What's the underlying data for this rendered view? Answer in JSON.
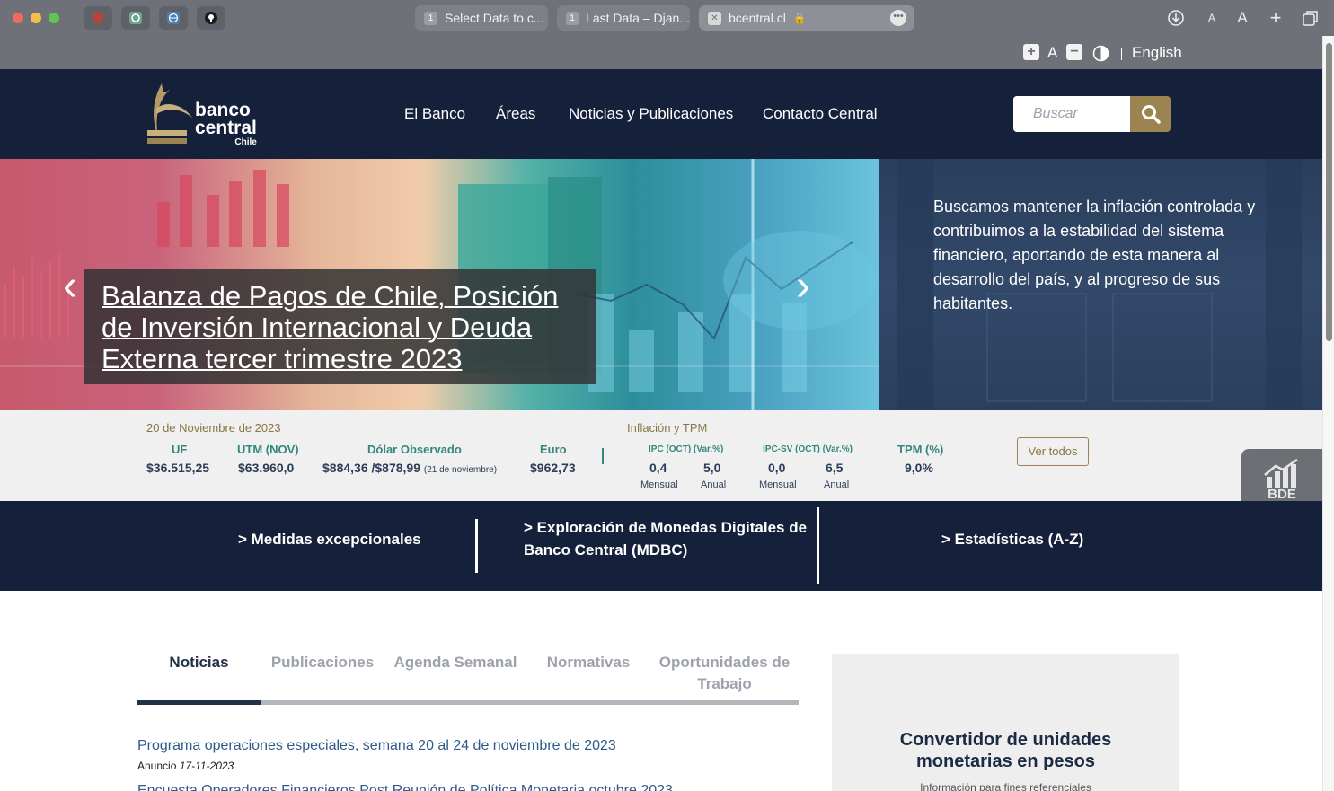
{
  "browser": {
    "tabs": [
      {
        "count": "1",
        "label": "Select Data to c..."
      },
      {
        "count": "1",
        "label": "Last Data – Djan..."
      },
      {
        "label": "bcentral.cl"
      }
    ],
    "extensions": [
      "shield-icon",
      "chatgpt-icon",
      "globe-icon",
      "github-icon"
    ],
    "colors": {
      "chrome": "#6e7177"
    }
  },
  "a11y": {
    "font_increase": "+",
    "font_label": "A",
    "font_decrease": "−",
    "language": "English"
  },
  "header": {
    "logo": {
      "line1": "banco",
      "line2": "central",
      "line3": "Chile"
    },
    "nav": [
      "El Banco",
      "Áreas",
      "Noticias y Publicaciones",
      "Contacto Central"
    ],
    "search_placeholder": "Buscar",
    "colors": {
      "navy": "#15213a",
      "gold": "#9b8451"
    }
  },
  "hero": {
    "slide_title": "Balanza de Pagos de Chile, Posición de Inversión Internacional y Deuda Externa tercer trimestre 2023",
    "mission": "Buscamos mantener la inflación controlada y contribuimos a la estabilidad del sistema financiero, aportando de esta manera al desarrollo del país, y al progreso de sus habitantes.",
    "prev": "‹",
    "next": "›"
  },
  "indicators": {
    "date": "20 de Noviembre de 2023",
    "items": [
      {
        "label": "UF",
        "value": "$36.515,25"
      },
      {
        "label": "UTM (NOV)",
        "value": "$63.960,0"
      },
      {
        "label": "Dólar Observado",
        "value": "$884,36 /$878,99",
        "note": "(21 de noviembre)"
      },
      {
        "label": "Euro",
        "value": "$962,73"
      }
    ],
    "inflation_title": "Inflación y TPM",
    "ipc": {
      "label": "IPC (OCT) (Var.%)",
      "mensual": "0,4",
      "anual": "5,0"
    },
    "ipcsv": {
      "label": "IPC-SV (OCT) (Var.%)",
      "mensual": "0,0",
      "anual": "6,5"
    },
    "tpm": {
      "label": "TPM (%)",
      "value": "9,0%"
    },
    "cap_mensual": "Mensual",
    "cap_anual": "Anual",
    "ver_todos": "Ver todos",
    "bde_label": "BDE",
    "colors": {
      "teal": "#33887e",
      "gold_text": "#8d7444"
    }
  },
  "quick_links": [
    {
      "label": "> Medidas excepcionales"
    },
    {
      "label_l1": "> Exploración de Monedas Digitales de",
      "label_l2": "Banco Central (MDBC)"
    },
    {
      "label": "> Estadísticas (A-Z)"
    }
  ],
  "content": {
    "tabs": [
      {
        "label": "Noticias"
      },
      {
        "label": "Publicaciones"
      },
      {
        "label": "Agenda Semanal"
      },
      {
        "label": "Normativas"
      },
      {
        "label_l1": "Oportunidades de",
        "label_l2": "Trabajo"
      }
    ],
    "news": [
      {
        "title": "Programa operaciones especiales, semana 20 al 24 de noviembre de 2023",
        "type": "Anuncio",
        "date": "17-11-2023"
      },
      {
        "title": "Encuesta Operadores Financieros Post Reunión de Política Monetaria octubre 2023"
      }
    ],
    "converter": {
      "title_l1": "Convertidor de unidades",
      "title_l2": "monetarias en pesos",
      "subtitle": "Información para fines referenciales"
    }
  }
}
